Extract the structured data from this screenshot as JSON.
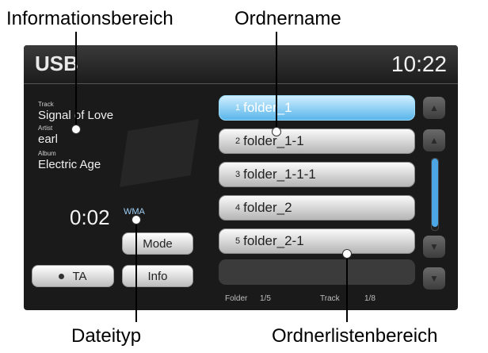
{
  "callouts": {
    "info_area": "Informationsbereich",
    "folder_name": "Ordnername",
    "file_type": "Dateityp",
    "folder_list_area": "Ordnerlistenbereich"
  },
  "header": {
    "source": "USB",
    "clock": "10:22"
  },
  "now_playing": {
    "track_label": "Track",
    "track": "Signal of Love",
    "artist_label": "Artist",
    "artist": "earl",
    "album_label": "Album",
    "album": "Electric Age",
    "elapsed": "0:02",
    "file_type": "WMA"
  },
  "buttons": {
    "mode": "Mode",
    "ta": "TA",
    "info": "Info"
  },
  "folders": [
    {
      "num": "1",
      "name": "folder_1",
      "selected": true
    },
    {
      "num": "2",
      "name": "folder_1-1",
      "selected": false
    },
    {
      "num": "3",
      "name": "folder_1-1-1",
      "selected": false
    },
    {
      "num": "4",
      "name": "folder_2",
      "selected": false
    },
    {
      "num": "5",
      "name": "folder_2-1",
      "selected": false
    }
  ],
  "footer": {
    "folder_label": "Folder",
    "folder_count": "1/5",
    "track_label": "Track",
    "track_count": "1/8"
  },
  "icons": [
    "scroll-top-icon",
    "scroll-up-icon",
    "scroll-down-icon",
    "scroll-bottom-icon"
  ],
  "colors": {
    "selected": "#59b6ea",
    "scroll_thumb": "#4ba6e3",
    "file_type": "#9fcff5"
  }
}
